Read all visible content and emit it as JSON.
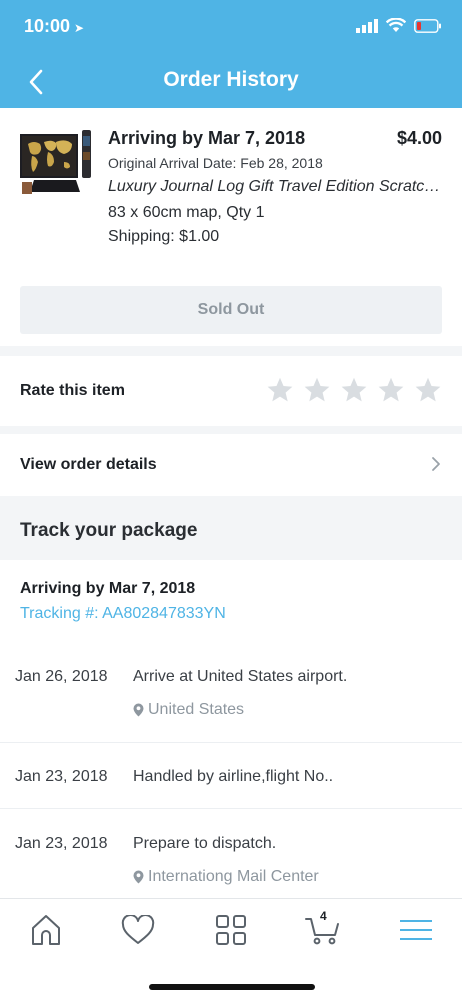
{
  "status_bar": {
    "time": "10:00"
  },
  "nav": {
    "title": "Order History"
  },
  "product": {
    "arriving": "Arriving by Mar 7, 2018",
    "price": "$4.00",
    "original_arrival": "Original Arrival Date: Feb 28, 2018",
    "name": "Luxury Journal Log Gift Travel Edition Scratch Off World Map",
    "spec": "83 x 60cm map, Qty 1",
    "shipping": "Shipping: $1.00",
    "status_button": "Sold Out"
  },
  "rating": {
    "label": "Rate this item",
    "stars": 5,
    "value": 0
  },
  "details": {
    "label": "View order details"
  },
  "tracking": {
    "title": "Track your package",
    "arriving": "Arriving by Mar 7, 2018",
    "number": "Tracking #: AA802847833YN",
    "events": [
      {
        "date": "Jan 26, 2018",
        "description": "Arrive at United States airport.",
        "location": "United States"
      },
      {
        "date": "Jan 23, 2018",
        "description": "Handled by airline,flight No..",
        "location": ""
      },
      {
        "date": "Jan 23, 2018",
        "description": "Prepare to dispatch.",
        "location": "Internationg Mail Center"
      }
    ]
  },
  "tab_bar": {
    "cart_count": "4"
  },
  "colors": {
    "accent": "#4fb4e5",
    "star": "#d9dde1",
    "muted": "#8e979f"
  }
}
